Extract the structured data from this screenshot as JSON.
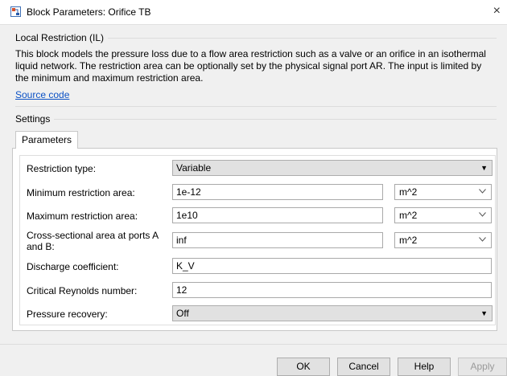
{
  "window": {
    "title": "Block Parameters: Orifice TB",
    "close_glyph": "×"
  },
  "header_section": {
    "label": "Local Restriction (IL)",
    "description": "This block models the pressure loss due to a flow area restriction such as a valve or an orifice in an isothermal liquid network. The restriction area can be optionally set by the physical signal port AR. The input is limited by the minimum and maximum restriction area.",
    "source_link": "Source code"
  },
  "settings": {
    "label": "Settings",
    "tab": "Parameters",
    "rows": {
      "restriction_type": {
        "label": "Restriction type:",
        "value": "Variable"
      },
      "min_area": {
        "label": "Minimum restriction area:",
        "value": "1e-12",
        "unit": "m^2"
      },
      "max_area": {
        "label": "Maximum restriction area:",
        "value": "1e10",
        "unit": "m^2"
      },
      "cross_area": {
        "label_line1": "Cross-sectional area at ports A",
        "label_line2": "and B:",
        "value": "inf",
        "unit": "m^2"
      },
      "discharge": {
        "label": "Discharge coefficient:",
        "value": "K_V"
      },
      "reynolds": {
        "label": "Critical Reynolds number:",
        "value": "12"
      },
      "pressure_recovery": {
        "label": "Pressure recovery:",
        "value": "Off"
      }
    }
  },
  "buttons": {
    "ok": "OK",
    "cancel": "Cancel",
    "help": "Help",
    "apply": "Apply"
  },
  "icons": {
    "app": "simulink-block-icon",
    "dropdown": "dropdown-triangle-icon",
    "unit_dropdown": "chevron-down-icon"
  },
  "colors": {
    "link": "#0b51c5",
    "background": "#f0f0f0"
  }
}
